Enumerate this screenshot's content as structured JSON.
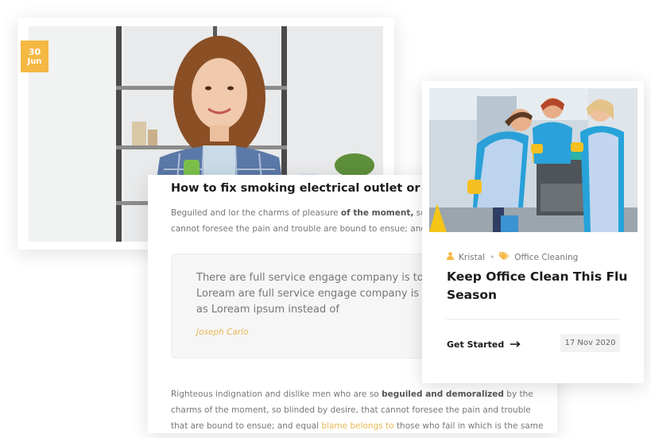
{
  "post_date": {
    "day": "30",
    "month": "Jun"
  },
  "article": {
    "title": "How to fix smoking electrical outlet or better.",
    "intro_start": "Beguiled and lor the charms of pleasure ",
    "intro_bold": "of the moment,",
    "intro_end": " so blinded by desire, that they cannot foresee the pain and trouble are bound to ensue; and equal blame belongs",
    "quote": "There are full service engage company is to provide company Loream are full service engage company is to provide solrtner as Loream ipsum instead of",
    "quote_author": "Joseph Carlo",
    "body_start": "Righteous indignation and dislike men who are so ",
    "body_bold": "beguiled and demoralized",
    "body_mid": " by the charms of the moment, so blinded by desire, that cannot foresee the pain and trouble that are bound to ensue; and equal ",
    "body_link": "blame belongs to",
    "body_end": " those who fail in which is the same as saying"
  },
  "blog_card": {
    "author": "Kristal",
    "category": "Office Cleaning",
    "title": "Keep Office Clean This Flu Season",
    "cta": "Get Started",
    "date": "17 Nov 2020"
  },
  "icons": {
    "author": "user-icon",
    "category": "tags-icon",
    "cta": "arrow-right-icon"
  },
  "colors": {
    "accent": "#f5b843",
    "heading": "#1b1b1b",
    "text": "#777777"
  }
}
